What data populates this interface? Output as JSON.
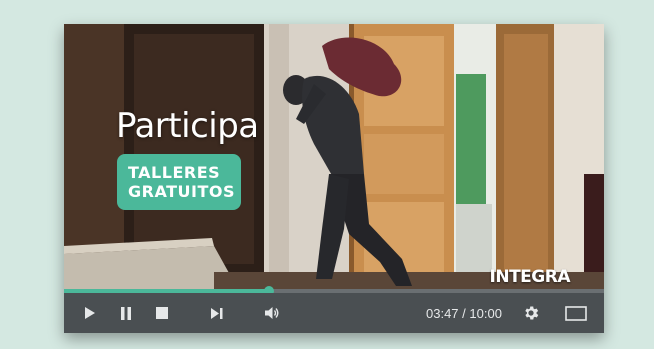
{
  "overlay": {
    "headline": "Participa",
    "badge_line1": "TALLERES",
    "badge_line2": "GRATUITOS",
    "brand": "INTEGRA"
  },
  "player": {
    "current_time": "03:47",
    "total_time": "10:00",
    "time_separator": " / ",
    "progress_fraction": 0.379,
    "accent_color": "#4bb89a"
  },
  "controls": {
    "icons": [
      "play-icon",
      "pause-icon",
      "stop-icon",
      "skip-next-icon",
      "volume-icon",
      "gear-icon",
      "fullscreen-icon"
    ]
  }
}
